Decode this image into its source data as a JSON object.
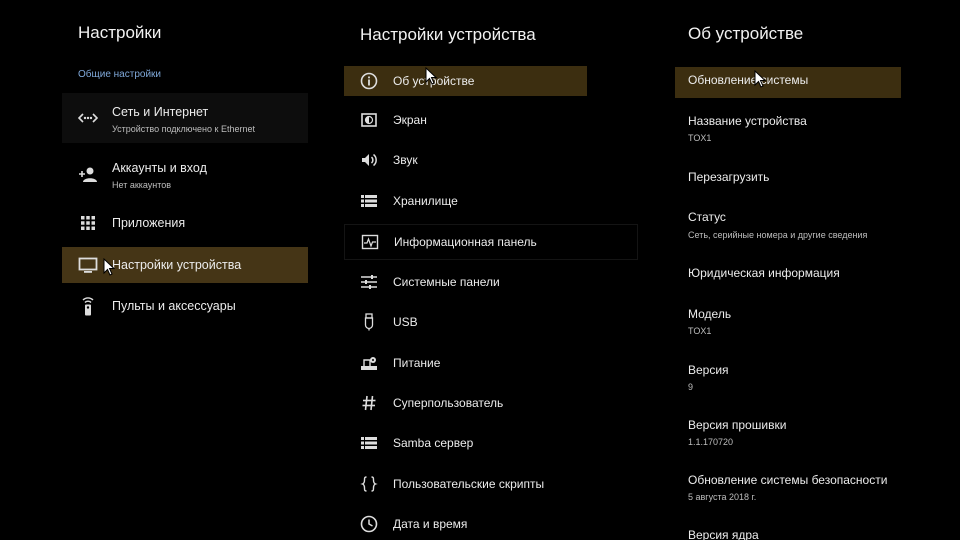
{
  "panel1": {
    "title": "Настройки",
    "section": "Общие настройки",
    "items": [
      {
        "label": "Сеть и Интернет",
        "sub": "Устройство подключено к Ethernet",
        "icon": "network-icon"
      },
      {
        "label": "Аккаунты и вход",
        "sub": "Нет аккаунтов",
        "icon": "add-account-icon"
      },
      {
        "label": "Приложения",
        "icon": "apps-grid-icon"
      },
      {
        "label": "Настройки устройства",
        "icon": "tv-icon",
        "selected": true
      },
      {
        "label": "Пульты и аксессуары",
        "icon": "remote-icon"
      }
    ]
  },
  "panel2": {
    "title": "Настройки устройства",
    "items": [
      {
        "label": "Об устройстве",
        "icon": "info-icon",
        "selected": true
      },
      {
        "label": "Экран",
        "icon": "display-icon"
      },
      {
        "label": "Звук",
        "icon": "speaker-icon"
      },
      {
        "label": "Хранилище",
        "icon": "storage-icon"
      },
      {
        "label": "Информационная панель",
        "icon": "dashboard-icon"
      },
      {
        "label": "Системные панели",
        "icon": "sliders-icon"
      },
      {
        "label": "USB",
        "icon": "usb-icon"
      },
      {
        "label": "Питание",
        "icon": "power-icon"
      },
      {
        "label": "Суперпользователь",
        "icon": "hash-icon"
      },
      {
        "label": "Samba сервер",
        "icon": "server-icon"
      },
      {
        "label": "Пользовательские скрипты",
        "icon": "braces-icon"
      },
      {
        "label": "Дата и время",
        "icon": "clock-icon"
      }
    ]
  },
  "panel3": {
    "title": "Об устройстве",
    "items": [
      {
        "label": "Обновление системы",
        "selected": true
      },
      {
        "label": "Название устройства",
        "sub": "TOX1"
      },
      {
        "label": "Перезагрузить"
      },
      {
        "label": "Статус",
        "sub": "Сеть, серийные номера и другие сведения"
      },
      {
        "label": "Юридическая информация"
      },
      {
        "label": "Модель",
        "sub": "TOX1"
      },
      {
        "label": "Версия",
        "sub": "9"
      },
      {
        "label": "Версия прошивки",
        "sub": "1.1.170720"
      },
      {
        "label": "Обновление системы безопасности",
        "sub": "5 августа 2018 г."
      },
      {
        "label": "Версия ядра"
      }
    ]
  },
  "colors": {
    "background": "#000000",
    "selected": "#453516",
    "section": "#7fa8d9"
  }
}
